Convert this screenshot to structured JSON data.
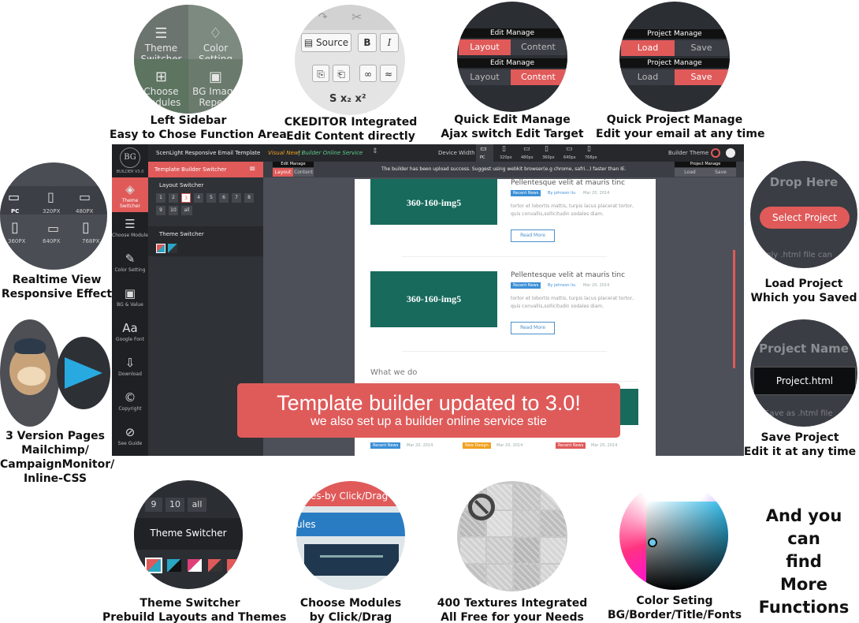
{
  "features": {
    "sidebar": {
      "caption": [
        "Left Sidebar",
        "Easy to Chose Function Area"
      ],
      "tiles": [
        "Theme Switcher",
        "Color Setting",
        "Choose Modules",
        "BG Image Repeat"
      ]
    },
    "ckeditor": {
      "caption": [
        "CKEDITOR Integrated",
        "Edit Content directly"
      ],
      "source_label": "Source",
      "bold": "B",
      "italic": "I"
    },
    "quick_edit": {
      "caption": [
        "Quick Edit Manage",
        "Ajax switch Edit Target"
      ],
      "heading": "Edit Manage",
      "layout": "Layout",
      "content": "Content"
    },
    "quick_project": {
      "caption": [
        "Quick Project Manage",
        "Edit your email at any time"
      ],
      "heading": "Project Manage",
      "load": "Load",
      "save": "Save"
    },
    "realtime": {
      "caption": [
        "Realtime View",
        "Responsive Effect"
      ],
      "devices": [
        "PC",
        "320PX",
        "480PX",
        "360PX",
        "640PX",
        "768PX"
      ]
    },
    "versions": {
      "caption": [
        "3 Version Pages",
        "Mailchimp/",
        "CampaignMonitor/",
        "Inline-CSS"
      ]
    },
    "load_project": {
      "caption": [
        "Load Project",
        "Which you Saved"
      ],
      "drop": "Drop Here",
      "button": "Select Project",
      "hint": "only .html file can"
    },
    "save_project": {
      "caption": [
        "Save Project",
        "Edit it at any time"
      ],
      "heading": "Project Name",
      "value": "Project.html",
      "hint": "Save as .html file"
    },
    "theme_switcher": {
      "caption": [
        "Theme Switcher",
        "Prebuild Layouts and Themes"
      ],
      "label": "Theme Switcher",
      "numbers": [
        "9",
        "10",
        "all"
      ]
    },
    "modules": {
      "caption": [
        "Choose Modules",
        "by Click/Drag"
      ],
      "text1": "es-by Click/Drag",
      "text2": "ules"
    },
    "textures": {
      "caption": [
        "400 Textures Integrated",
        "All Free for your Needs"
      ]
    },
    "color": {
      "caption": [
        "Color Seting",
        "BG/Border/Title/Fonts"
      ]
    }
  },
  "screenshot": {
    "topbar": {
      "title": "ScenLight Responsive Email Template",
      "visual": "Visual New!",
      "builder": "| Builder Online Service",
      "device_label": "Device Width",
      "devices": [
        "PC",
        "320px",
        "480px",
        "360px",
        "640px",
        "768px"
      ],
      "theme_label": "Builder Theme"
    },
    "nav": [
      {
        "icon": "layers-icon",
        "label": "Theme Switcher"
      },
      {
        "icon": "list-icon",
        "label": "Choose Module"
      },
      {
        "icon": "brush-icon",
        "label": "Color Setting"
      },
      {
        "icon": "image-icon",
        "label": "BG & Value"
      },
      {
        "icon": "font-icon",
        "label": "Google Font"
      },
      {
        "icon": "download-icon",
        "label": "Download"
      },
      {
        "icon": "copyright-icon",
        "label": "Copyright"
      },
      {
        "icon": "compass-icon",
        "label": "See Guide"
      }
    ],
    "logo": "BG",
    "logo_sub": "BUILDER V3.0",
    "panel": {
      "title": "Template Builder Switcher",
      "layout_label": "Layout Switcher",
      "layouts": [
        "1",
        "2",
        "3",
        "4",
        "5",
        "6",
        "7",
        "8",
        "9",
        "10",
        "all"
      ],
      "theme_label": "Theme Switcher"
    },
    "edit_manage": {
      "heading": "Edit Manage",
      "layout": "Layout",
      "content": "Content"
    },
    "project_manage": {
      "heading": "Project Manage",
      "load": "Load",
      "save": "Save"
    },
    "notice": "The builder has been upload success. Suggest using webkit browser(e.g chrome, safri...) faster than IE.",
    "articles": [
      {
        "img": "360-160-img5",
        "title": "Pellentesque velit at mauris tinc",
        "tag": "Recent News",
        "author": "By johnson liu",
        "date": "Mar 20, 2014",
        "excerpt": "tortor et lobortis mattis, turpis lacus placerat tortor, quis convallis,sollicitudin sodales diam.",
        "more": "Read More"
      },
      {
        "img": "360-160-img5",
        "title": "Pellentesque velit at mauris tinc",
        "tag": "Recent News",
        "author": "By johnson liu",
        "date": "Mar 20, 2014",
        "excerpt": "tortor et lobortis mattis, turpis lacus placerat tortor, quis convallis,sollicitudin sodales diam.",
        "more": "Read More"
      }
    ],
    "section": "What we do",
    "footer_tags": [
      {
        "tag": "Recent News",
        "date": "Mar 20, 2014",
        "color": "#3b8fd6"
      },
      {
        "tag": "New Design",
        "date": "Mar 20, 2014",
        "color": "#f0a020"
      },
      {
        "tag": "Recent News",
        "date": "Mar 20, 2014",
        "color": "#e05a5a"
      }
    ]
  },
  "banner": {
    "line1": "Template builder updated to 3.0!",
    "line2": "we also set up a builder online service stie"
  },
  "more": [
    "And you can",
    "find",
    "More",
    "Functions"
  ],
  "colors": {
    "accent": "#e05a5a",
    "teal": "#176a5c",
    "dark": "#2b2e33"
  }
}
